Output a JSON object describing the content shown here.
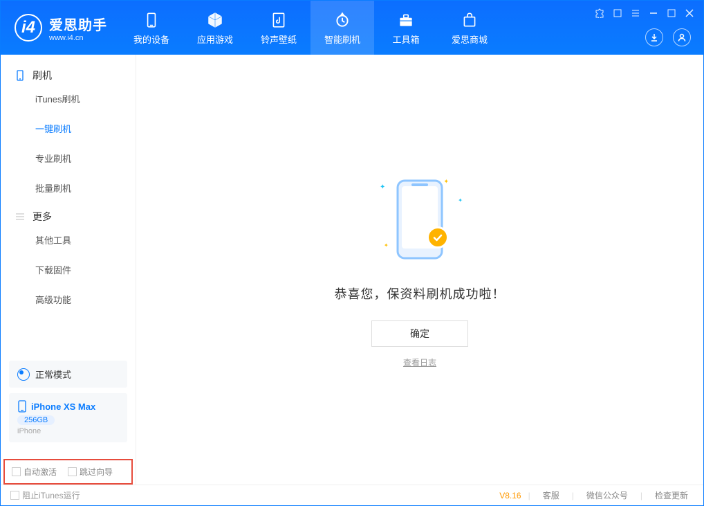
{
  "app": {
    "title": "爱思助手",
    "subtitle": "www.i4.cn"
  },
  "nav": {
    "items": [
      {
        "label": "我的设备",
        "icon": "device"
      },
      {
        "label": "应用游戏",
        "icon": "cube"
      },
      {
        "label": "铃声壁纸",
        "icon": "music"
      },
      {
        "label": "智能刷机",
        "icon": "refresh",
        "active": true
      },
      {
        "label": "工具箱",
        "icon": "toolbox"
      },
      {
        "label": "爱思商城",
        "icon": "store"
      }
    ]
  },
  "sidebar": {
    "group1": {
      "title": "刷机"
    },
    "items1": [
      {
        "label": "iTunes刷机"
      },
      {
        "label": "一键刷机",
        "active": true
      },
      {
        "label": "专业刷机"
      },
      {
        "label": "批量刷机"
      }
    ],
    "group2": {
      "title": "更多"
    },
    "items2": [
      {
        "label": "其他工具"
      },
      {
        "label": "下载固件"
      },
      {
        "label": "高级功能"
      }
    ],
    "mode": {
      "label": "正常模式"
    },
    "device": {
      "name": "iPhone XS Max",
      "storage": "256GB",
      "type": "iPhone"
    },
    "checkboxes": {
      "auto_activate": "自动激活",
      "skip_guide": "跳过向导"
    }
  },
  "main": {
    "success_message": "恭喜您，保资料刷机成功啦！",
    "ok_button": "确定",
    "view_log": "查看日志"
  },
  "footer": {
    "block_itunes": "阻止iTunes运行",
    "version": "V8.16",
    "links": {
      "support": "客服",
      "wechat": "微信公众号",
      "check_update": "检查更新"
    }
  }
}
